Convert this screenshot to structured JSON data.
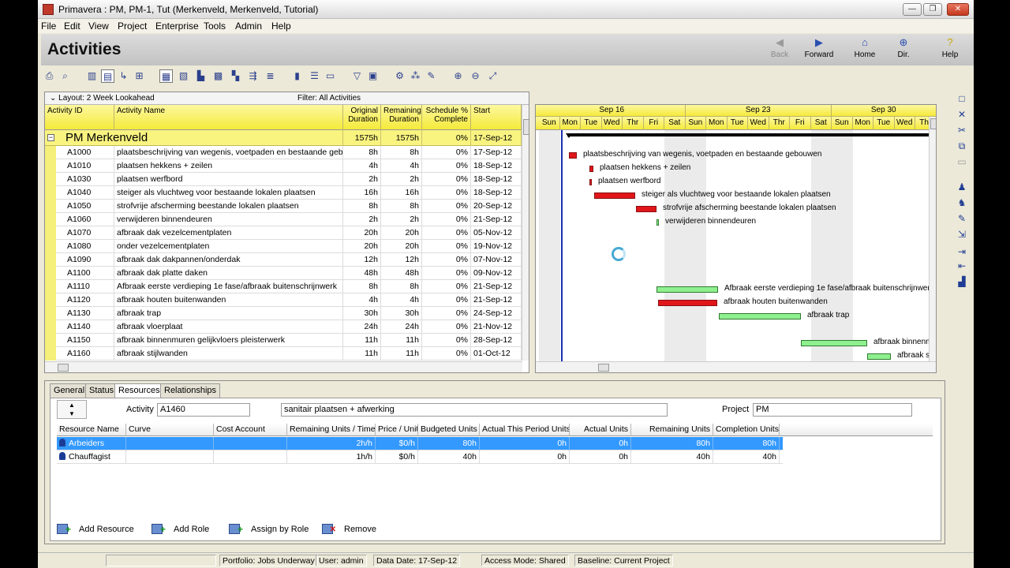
{
  "window": {
    "title": "Primavera : PM, PM-1, Tut (Merkenveld, Merkenveld, Tutorial)"
  },
  "menu": [
    "File",
    "Edit",
    "View",
    "Project",
    "Enterprise",
    "Tools",
    "Admin",
    "Help"
  ],
  "header": {
    "title": "Activities",
    "nav": {
      "back": "Back",
      "forward": "Forward",
      "home": "Home",
      "dir": "Dir.",
      "help": "Help"
    }
  },
  "grid": {
    "layout_label": "Layout: 2 Week Lookahead",
    "filter_label": "Filter: All Activities",
    "columns": {
      "id": "Activity ID",
      "name": "Activity Name",
      "orig": [
        "Original",
        "Duration"
      ],
      "rem": [
        "Remaining",
        "Duration"
      ],
      "sched": [
        "Schedule %",
        "Complete"
      ],
      "start": "Start"
    },
    "group": {
      "name": "PM  Merkenveld",
      "orig": "1575h",
      "rem": "1575h",
      "pct": "0%",
      "start": "17-Sep-12"
    },
    "rows": [
      {
        "id": "A1000",
        "name": "plaatsbeschrijving van wegenis, voetpaden en bestaande gebouwen",
        "orig": "8h",
        "rem": "8h",
        "pct": "0%",
        "start": "17-Sep-12"
      },
      {
        "id": "A1010",
        "name": "plaatsen hekkens + zeilen",
        "orig": "4h",
        "rem": "4h",
        "pct": "0%",
        "start": "18-Sep-12"
      },
      {
        "id": "A1030",
        "name": "plaatsen werfbord",
        "orig": "2h",
        "rem": "2h",
        "pct": "0%",
        "start": "18-Sep-12"
      },
      {
        "id": "A1040",
        "name": "steiger als vluchtweg voor bestaande lokalen plaatsen",
        "orig": "16h",
        "rem": "16h",
        "pct": "0%",
        "start": "18-Sep-12"
      },
      {
        "id": "A1050",
        "name": "strofvrije afscherming beestande lokalen plaatsen",
        "orig": "8h",
        "rem": "8h",
        "pct": "0%",
        "start": "20-Sep-12"
      },
      {
        "id": "A1060",
        "name": "verwijderen binnendeuren",
        "orig": "2h",
        "rem": "2h",
        "pct": "0%",
        "start": "21-Sep-12"
      },
      {
        "id": "A1070",
        "name": "afbraak dak vezelcementplaten",
        "orig": "20h",
        "rem": "20h",
        "pct": "0%",
        "start": "05-Nov-12"
      },
      {
        "id": "A1080",
        "name": "onder vezelcementplaten",
        "orig": "20h",
        "rem": "20h",
        "pct": "0%",
        "start": "19-Nov-12"
      },
      {
        "id": "A1090",
        "name": "afbraak dak dakpannen/onderdak",
        "orig": "12h",
        "rem": "12h",
        "pct": "0%",
        "start": "07-Nov-12"
      },
      {
        "id": "A1100",
        "name": "afbraak dak platte daken",
        "orig": "48h",
        "rem": "48h",
        "pct": "0%",
        "start": "09-Nov-12"
      },
      {
        "id": "A1110",
        "name": "Afbraak eerste verdieping 1e fase/afbraak buitenschrijnwerk",
        "orig": "8h",
        "rem": "8h",
        "pct": "0%",
        "start": "21-Sep-12"
      },
      {
        "id": "A1120",
        "name": "afbraak houten buitenwanden",
        "orig": "4h",
        "rem": "4h",
        "pct": "0%",
        "start": "21-Sep-12"
      },
      {
        "id": "A1130",
        "name": "afbraak trap",
        "orig": "30h",
        "rem": "30h",
        "pct": "0%",
        "start": "24-Sep-12"
      },
      {
        "id": "A1140",
        "name": "afbraak vloerplaat",
        "orig": "24h",
        "rem": "24h",
        "pct": "0%",
        "start": "21-Nov-12"
      },
      {
        "id": "A1150",
        "name": "afbraak binnenmuren gelijkvloers pleisterwerk",
        "orig": "11h",
        "rem": "11h",
        "pct": "0%",
        "start": "28-Sep-12"
      },
      {
        "id": "A1160",
        "name": "afbraak stijlwanden",
        "orig": "11h",
        "rem": "11h",
        "pct": "0%",
        "start": "01-Oct-12"
      }
    ]
  },
  "gantt": {
    "months": [
      "Sep 16",
      "Sep 23",
      "Sep 30"
    ],
    "days": [
      "Sun",
      "Mon",
      "Tue",
      "Wed",
      "Thr",
      "Fri",
      "Sat",
      "Sun",
      "Mon",
      "Tue",
      "Wed",
      "Thr",
      "Fri",
      "Sat",
      "Sun",
      "Mon",
      "Tue",
      "Wed",
      "Thr"
    ],
    "bars": [
      {
        "row": 0,
        "label": "plaatsbeschrijving van wegenis, voetpaden en bestaande gebouwen",
        "color": "#e0161b"
      },
      {
        "row": 1,
        "label": "plaatsen hekkens + zeilen",
        "color": "#e0161b"
      },
      {
        "row": 2,
        "label": "plaatsen werfbord",
        "color": "#e0161b"
      },
      {
        "row": 3,
        "label": "steiger als vluchtweg voor bestaande lokalen plaatsen",
        "color": "#e0161b"
      },
      {
        "row": 4,
        "label": "strofvrije afscherming beestande lokalen plaatsen",
        "color": "#e0161b"
      },
      {
        "row": 5,
        "label": "verwijderen binnendeuren",
        "color": "#8ef08e"
      },
      {
        "row": 10,
        "label": "Afbraak eerste verdieping 1e fase/afbraak buitenschrijnwerk",
        "color": "#8ef08e"
      },
      {
        "row": 11,
        "label": "afbraak houten buitenwanden",
        "color": "#e0161b"
      },
      {
        "row": 12,
        "label": "afbraak trap",
        "color": "#8ef08e"
      },
      {
        "row": 14,
        "label": "afbraak binnenmu",
        "color": "#8ef08e"
      },
      {
        "row": 15,
        "label": "afbraak stijl",
        "color": "#8ef08e"
      }
    ]
  },
  "detail": {
    "tabs": [
      "General",
      "Status",
      "Resources",
      "Relationships"
    ],
    "active_tab": "Resources",
    "activity_label": "Activity",
    "activity_id": "A1460",
    "activity_name": "sanitair plaatsen + afwerking",
    "project_label": "Project",
    "project_value": "PM",
    "res_columns": [
      "Resource Name",
      "Curve",
      "Cost Account",
      "Remaining Units / Time",
      "Price / Unit",
      "Budgeted Units",
      "Actual This Period Units",
      "Actual Units",
      "Remaining Units",
      "Completion Units"
    ],
    "resources": [
      {
        "name": "Arbeiders",
        "curve": "",
        "cost": "",
        "rut": "2h/h",
        "price": "$0/h",
        "budget": "80h",
        "atp": "0h",
        "actual": "0h",
        "remain": "80h",
        "complete": "80h",
        "selected": true
      },
      {
        "name": "Chauffagist",
        "curve": "",
        "cost": "",
        "rut": "1h/h",
        "price": "$0/h",
        "budget": "40h",
        "atp": "0h",
        "actual": "0h",
        "remain": "40h",
        "complete": "40h",
        "selected": false
      }
    ],
    "buttons": {
      "add_resource": "Add Resource",
      "add_role": "Add Role",
      "assign_by_role": "Assign by Role",
      "remove": "Remove"
    }
  },
  "status": {
    "portfolio": "Portfolio: Jobs Underway",
    "user": "User: admin",
    "data_date": "Data Date: 17-Sep-12",
    "access": "Access Mode: Shared",
    "baseline": "Baseline: Current Project"
  }
}
